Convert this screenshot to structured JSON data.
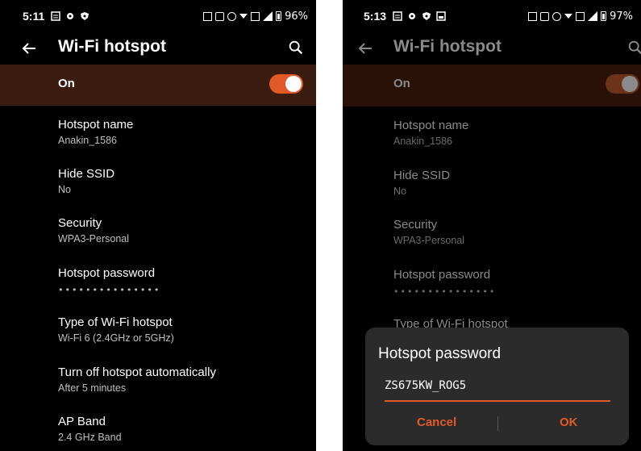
{
  "left": {
    "status": {
      "time": "5:11",
      "battery": "96%"
    },
    "appbar": {
      "title": "Wi-Fi hotspot"
    },
    "on_row": {
      "label": "On",
      "toggle_on": true
    },
    "items": [
      {
        "title": "Hotspot name",
        "subtitle": "Anakin_1586"
      },
      {
        "title": "Hide SSID",
        "subtitle": "No"
      },
      {
        "title": "Security",
        "subtitle": "WPA3-Personal"
      },
      {
        "title": "Hotspot password",
        "subtitle": "•••••••••••••••"
      },
      {
        "title": "Type of Wi-Fi hotspot",
        "subtitle": "Wi-Fi 6 (2.4GHz or 5GHz)"
      },
      {
        "title": "Turn off hotspot automatically",
        "subtitle": "After 5 minutes"
      },
      {
        "title": "AP Band",
        "subtitle": "2.4 GHz Band"
      }
    ]
  },
  "right": {
    "status": {
      "time": "5:13",
      "battery": "97%"
    },
    "appbar": {
      "title": "Wi-Fi hotspot"
    },
    "on_row": {
      "label": "On",
      "toggle_on": true
    },
    "items": [
      {
        "title": "Hotspot name",
        "subtitle": "Anakin_1586"
      },
      {
        "title": "Hide SSID",
        "subtitle": "No"
      },
      {
        "title": "Security",
        "subtitle": "WPA3-Personal"
      },
      {
        "title": "Hotspot password",
        "subtitle": "•••••••••••••••"
      },
      {
        "title": "Type of Wi-Fi hotspot",
        "subtitle": ""
      }
    ],
    "dialog": {
      "title": "Hotspot password",
      "input_value": "ZS675KW_ROG5",
      "cancel_label": "Cancel",
      "ok_label": "OK"
    }
  },
  "colors": {
    "accent": "#e15a26",
    "on_row_bg": "#3a1c10",
    "background": "#000000"
  }
}
